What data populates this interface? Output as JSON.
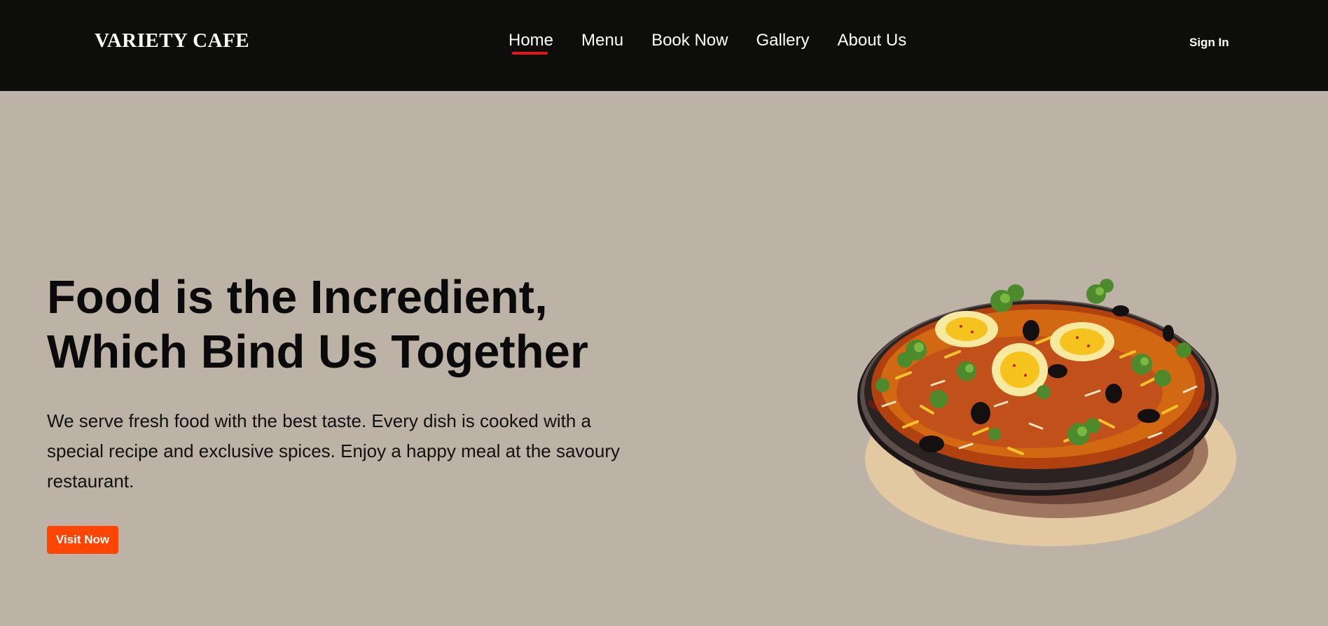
{
  "brand": {
    "name": "VARIETY CAFE"
  },
  "nav": {
    "items": [
      {
        "label": "Home",
        "active": true
      },
      {
        "label": "Menu",
        "active": false
      },
      {
        "label": "Book Now",
        "active": false
      },
      {
        "label": "Gallery",
        "active": false
      },
      {
        "label": "About Us",
        "active": false
      }
    ],
    "sign_in": "Sign In"
  },
  "hero": {
    "title_line1": "Food is the Incredient,",
    "title_line2": "Which Bind Us Together",
    "description": "We serve fresh food with the best taste. Every dish is cooked with a special recipe and exclusive spices. Enjoy a happy meal at the savoury restaurant.",
    "cta_label": "Visit Now",
    "image_icon": "biryani-dish-illustration"
  },
  "colors": {
    "navbar_bg": "#0d0d0b",
    "page_bg": "#bcb3a6",
    "accent_underline": "#e3171b",
    "cta_bg": "#ff4500"
  }
}
